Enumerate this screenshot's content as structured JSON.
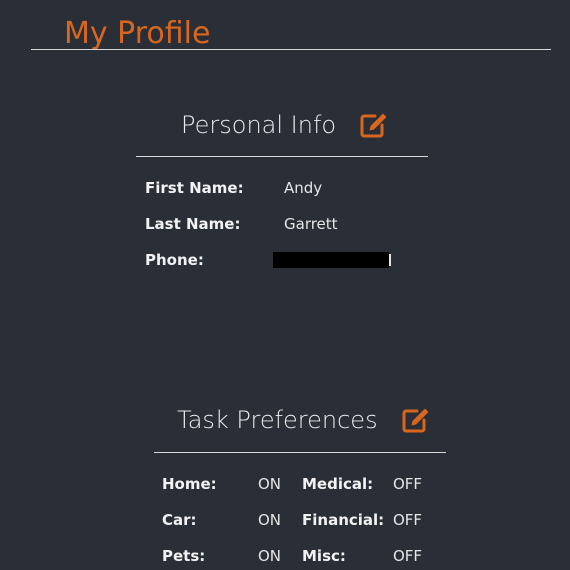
{
  "page": {
    "title": "My Profile"
  },
  "personal_info": {
    "heading": "Personal Info",
    "edit_icon": "edit-icon",
    "fields": [
      {
        "label": "First Name:",
        "value": "Andy"
      },
      {
        "label": "Last Name:",
        "value": "Garrett"
      },
      {
        "label": "Phone:",
        "value": ""
      }
    ]
  },
  "task_preferences": {
    "heading": "Task Preferences",
    "edit_icon": "edit-icon",
    "items": [
      {
        "label": "Home:",
        "value": "ON"
      },
      {
        "label": "Medical:",
        "value": "OFF"
      },
      {
        "label": "Car:",
        "value": "ON"
      },
      {
        "label": "Financial:",
        "value": "OFF"
      },
      {
        "label": "Pets:",
        "value": "ON"
      },
      {
        "label": "Misc:",
        "value": "OFF"
      }
    ]
  },
  "colors": {
    "background": "#2a2e37",
    "accent": "#d9661f",
    "text": "#e6e6e6"
  }
}
